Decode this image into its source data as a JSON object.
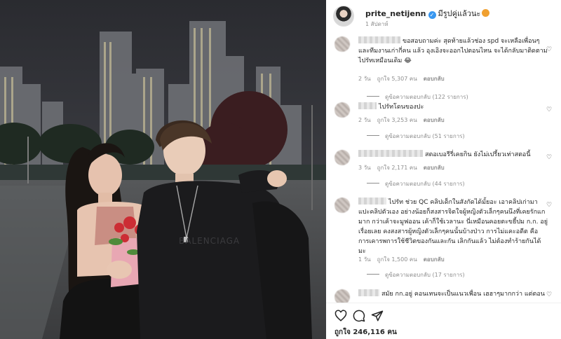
{
  "post": {
    "username": "prite_netijenn",
    "verified_icon": "verified-badge-icon",
    "caption": "มีรูปคู่แล้วนะ",
    "caption_emoji": "smile-emoji-icon",
    "time": "1 สัปดาห์",
    "likes": "ถูกใจ 246,116 คน",
    "photo_shirt_text": "BALENCIAGA"
  },
  "comments": [
    {
      "text": "ขอสอบถามค่ะ สุดท้ายแล้วช่อง spd จะเหลือเพื่อนๆและทีมงานเก่ากี่คน แล้ว อุงเอิงจะออกไปตอนไหน จะได้กลับมาติดตามไปรัทเหมือนเดิม 😂",
      "age": "2 วัน",
      "likes": "ถูกใจ 5,307 คน",
      "reply": "ตอบกลับ",
      "view_replies": "ดูข้อความตอบกลับ (122 รายการ)"
    },
    {
      "text": "ไปรัทโดนของปะ",
      "age": "2 วัน",
      "likes": "ถูกใจ 3,253 คน",
      "reply": "ตอบกลับ",
      "view_replies": "ดูข้อความตอบกลับ (51 รายการ)"
    },
    {
      "text": "สตอเบอรีรี่เคยกิน ยังไม่เปรี้ยวเท่าสตอนี้",
      "age": "3 วัน",
      "likes": "ถูกใจ 2,171 คน",
      "reply": "ตอบกลับ",
      "view_replies": "ดูข้อความตอบกลับ (44 รายการ)"
    },
    {
      "text": "ไปรัท ช่วย QC คลิปเด็กในสังกัดได้มั้ยอะ เอาคลิปเก่ามาแปะคลิปตัวเอง อย่างน้อยก็สงสารจิตใจผู้หญิงตัวเล็กๆคนนึงที่เคยรักแกมาก กว่าเค้าจะมูฟออน เค้าก็ใช้เวลานะ นี่เหมือนคอยตะขยี้ปม ก.ก. อยู่เรื่อยเลย คงสงสารผู้หญิงตัวเล็กๆคนนั้นบ้างป่าว การไม่แคะอดีต คือการเคารพการใช้ชีวิตของกันและกัน เลิกกันแล้ว ไม่ต้องทำร้ายกันได้มะ",
      "age": "1 วัน",
      "likes": "ถูกใจ 1,500 คน",
      "reply": "ตอบกลับ",
      "view_replies": "ดูข้อความตอบกลับ (17 รายการ)"
    },
    {
      "text": "สมัย กก.อยู่ คอนเทนจะเป็นแนวเพื่อน เฮฮาๆมากกว่า แต่ตอน"
    }
  ],
  "actions": {
    "like_icon": "heart-outline-icon",
    "comment_icon": "comment-bubble-icon",
    "share_icon": "paper-plane-icon"
  },
  "colors": {
    "text": "#262626",
    "secondary": "#8e8e8e",
    "verified": "#3897f0"
  }
}
